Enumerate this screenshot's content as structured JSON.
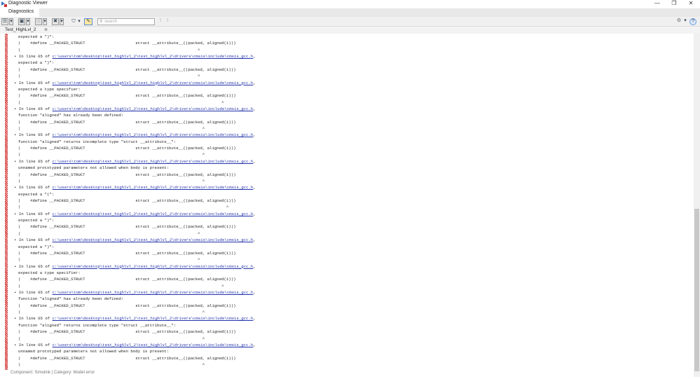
{
  "window": {
    "title": "Diagnostic Viewer",
    "minimize": "—",
    "restore": "❐",
    "close": "✕"
  },
  "menu": {
    "tab": "Diagnostics"
  },
  "toolbar": {
    "search_placeholder": "search",
    "up": "⇧",
    "down": "⇩",
    "settings": "⚙",
    "help": "?"
  },
  "tab": {
    "label": "Test_HighLvl_2",
    "close": "⊗"
  },
  "log": {
    "prefix": "In line 65 of ",
    "link": "c:\\users\\tom\\desktop\\test_highlvl_2\\test_highlvl_2\\drivers\\cmsis\\include\\cmsis_gcc.h",
    "suffix": ",",
    "code": "|    #define __PACKED_STRUCT                     struct __attribute__((packed, aligned(1)))",
    "first_partial": {
      "message": "expected a \")\":",
      "caret": "|                                                                          ^"
    },
    "entries": [
      {
        "message": "expected a \")\":",
        "caret": "|                                                                          ^"
      },
      {
        "message": "expected a type specifier:",
        "caret": "|                                                                                    ^"
      },
      {
        "message": "function \"aligned\" has already been defined:",
        "caret": "|                                                                            ^"
      },
      {
        "message": "function \"aligned\" returns incomplete type \"struct __attribute__\":",
        "caret": "|                                                                            ^"
      },
      {
        "message": "unnamed prototyped parameters not allowed when body is present:",
        "caret": "|                                                                            ^"
      },
      {
        "message": "expected a \"(\":",
        "caret": "|                                                                                      ^"
      },
      {
        "message": "expected a \")\":",
        "caret": "|                                                                          ^"
      },
      {
        "message": "expected a \")\":",
        "caret": "|                                                                          ^"
      },
      {
        "message": "expected a type specifier:",
        "caret": "|                                                                                    ^"
      },
      {
        "message": "function \"aligned\" has already been defined:",
        "caret": "|                                                                            ^"
      },
      {
        "message": "function \"aligned\" returns incomplete type \"struct __attribute__\":",
        "caret": "|                                                                            ^"
      },
      {
        "message": "unnamed prototyped parameters not allowed when body is present:",
        "caret": "|                                                                            ^"
      }
    ]
  },
  "status": "Component:  Simulink | Category:  Model error"
}
